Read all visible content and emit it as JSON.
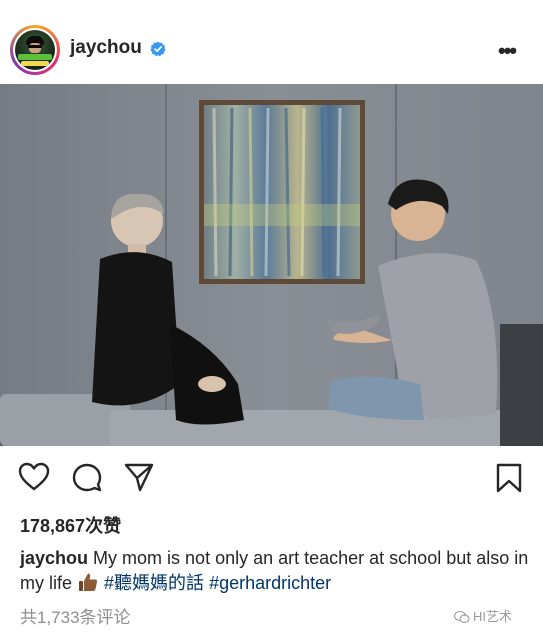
{
  "post": {
    "username": "jaychou",
    "likes": "178,867次赞",
    "caption_user": "jaychou",
    "caption_text": "My mom is not only an art teacher at school but also in my life",
    "hashtags": [
      "#聽媽媽的話",
      "#gerhardrichter"
    ],
    "comments": "共1,733条评论"
  },
  "watermark": "HI艺术",
  "icons": {
    "verified": "verified-badge-icon",
    "more": "more-options-icon",
    "like": "heart-icon",
    "comment": "comment-bubble-icon",
    "share": "paper-plane-icon",
    "save": "bookmark-icon",
    "thumb": "thumbs-up-emoji-icon"
  },
  "colors": {
    "verified_blue": "#3897f0",
    "hashtag_blue": "#003569",
    "muted_gray": "#8e8e8e"
  }
}
